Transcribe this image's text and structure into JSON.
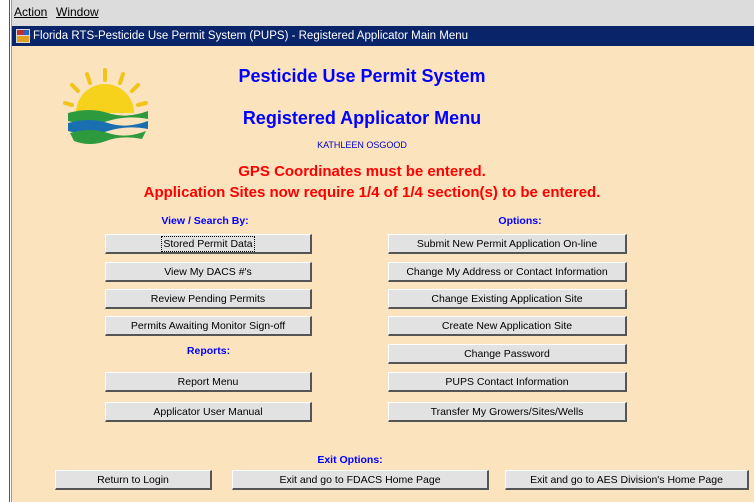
{
  "menubar": {
    "action": "Action",
    "window": "Window"
  },
  "window": {
    "title": "Florida RTS-Pesticide Use Permit System (PUPS) - Registered Applicator Main Menu"
  },
  "header": {
    "system_title": "Pesticide Use Permit System",
    "menu_title": "Registered Applicator Menu",
    "user_name": "KATHLEEN OSGOOD"
  },
  "notices": {
    "gps": "GPS Coordinates must be entered.",
    "sites": "Application Sites now require 1/4 of 1/4 section(s) to be entered."
  },
  "view_search": {
    "heading": "View / Search By:",
    "stored_permit": "Stored Permit Data",
    "dacs": "View My DACS #'s",
    "pending": "Review Pending Permits",
    "monitor": "Permits Awaiting Monitor Sign-off"
  },
  "reports": {
    "heading": "Reports:",
    "report_menu": "Report Menu",
    "manual": "Applicator User Manual"
  },
  "options": {
    "heading": "Options:",
    "submit": "Submit New Permit Application On-line",
    "address": "Change My Address or Contact Information",
    "existing_site": "Change Existing Application Site",
    "new_site": "Create New Application Site",
    "password": "Change Password",
    "contact": "PUPS Contact Information",
    "transfer": "Transfer My Growers/Sites/Wells"
  },
  "exit": {
    "heading": "Exit Options:",
    "login": "Return to Login",
    "fdacs": "Exit and go to FDACS Home Page",
    "aes": "Exit and go to AES Division's Home Page"
  },
  "colors": {
    "panel_bg": "#fbe3be",
    "title_blue": "#0000ff",
    "notice_red": "#ff0000",
    "titlebar_bg": "#0a246a"
  }
}
